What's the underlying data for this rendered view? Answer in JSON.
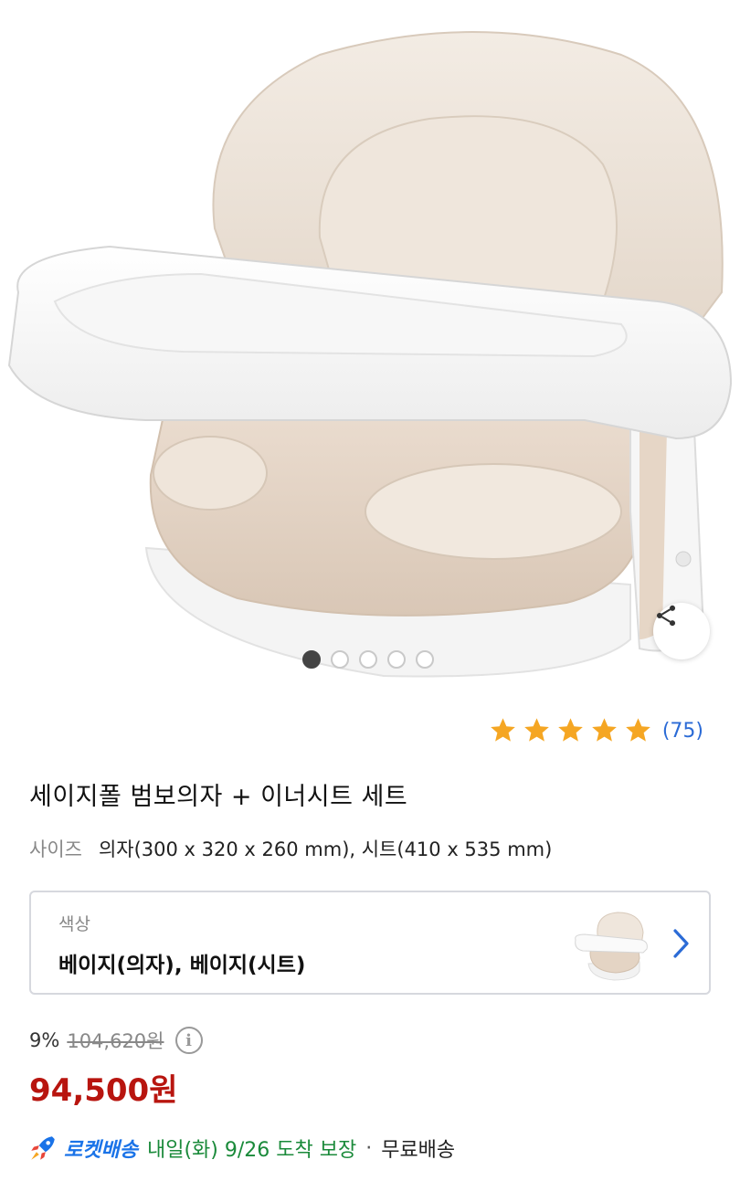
{
  "gallery": {
    "image_alt": "세이지폴 범보의자 + 이너시트 세트",
    "dot_count": 5,
    "active_dot": 0
  },
  "icons": {
    "share": "share-icon",
    "star": "star-icon",
    "chevron": "chevron-right-icon",
    "info": "info-icon",
    "rocket": "rocket-icon"
  },
  "rating": {
    "stars": 5,
    "count_text": "(75)",
    "star_color": "#f5a623"
  },
  "product": {
    "title": "세이지폴 범보의자 + 이너시트 세트",
    "size_label": "사이즈",
    "size_value": "의자(300 x 320 x 260 mm), 시트(410 x 535 mm)"
  },
  "option": {
    "label": "색상",
    "value": "베이지(의자), 베이지(시트)"
  },
  "price": {
    "discount": "9%",
    "original": "104,620원",
    "sale": "94,500원",
    "sale_color": "#b8150f"
  },
  "delivery": {
    "rocket_label": "로켓배송",
    "arrival": "내일(화) 9/26 도착 보장",
    "separator": "·",
    "free_shipping": "무료배송",
    "rocket_color": "#1a73e8",
    "arrival_color": "#1a8a3a"
  }
}
